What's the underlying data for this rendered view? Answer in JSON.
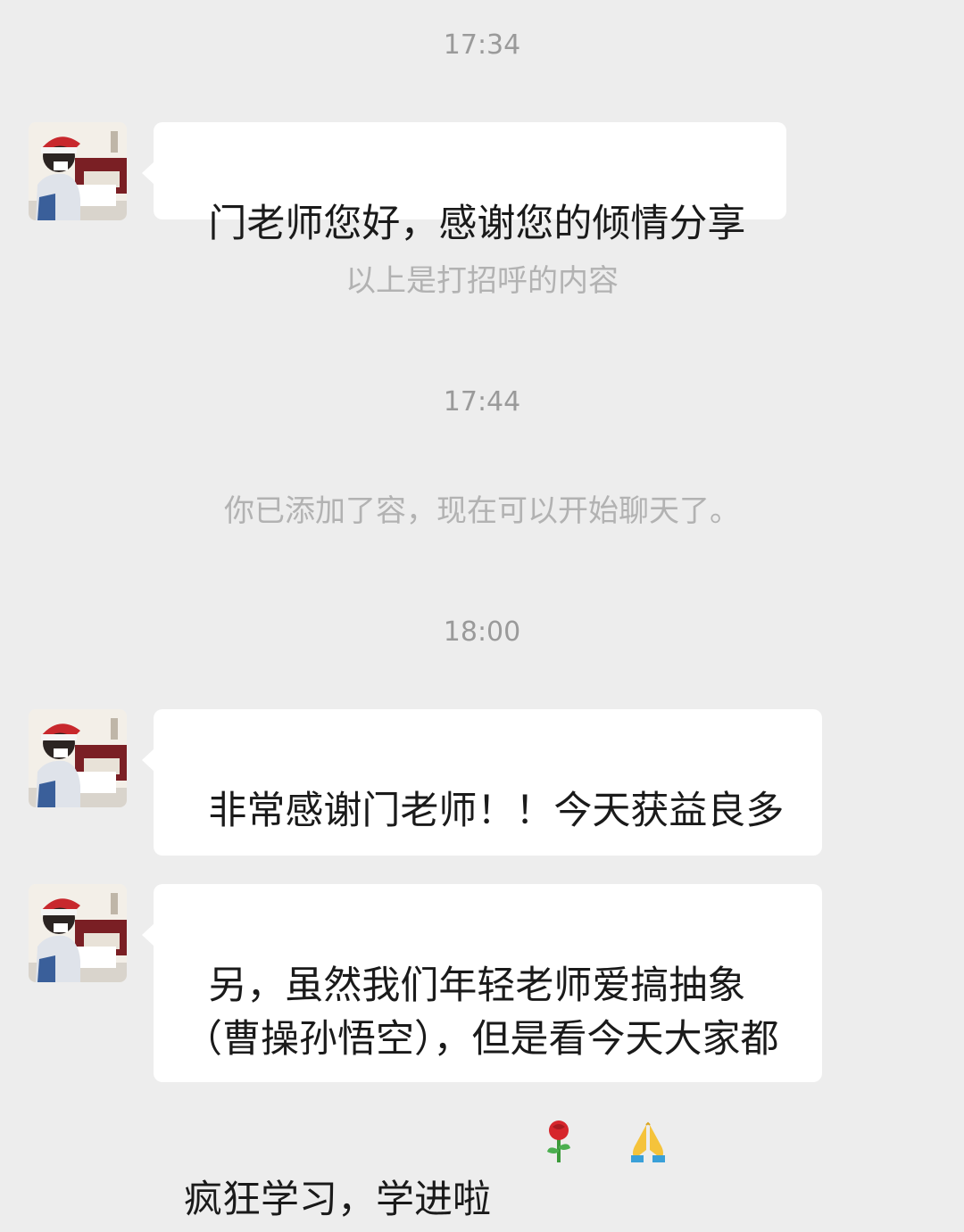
{
  "chat": {
    "timestamps": [
      "17:34",
      "17:44",
      "18:00"
    ],
    "system_notices": [
      "以上是打招呼的内容",
      "你已添加了容，现在可以开始聊天了。"
    ],
    "messages": [
      {
        "text": "门老师您好，感谢您的倾情分享",
        "emoji": []
      },
      {
        "text": "非常感谢门老师！！今天获益良多\n",
        "emoji": [
          "rose-icon"
        ]
      },
      {
        "text": "另，虽然我们年轻老师爱搞抽象（曹操孙悟空），但是看今天大家都疯狂学习，学进啦",
        "emoji": [
          "rose-icon",
          "folded-hands-icon"
        ]
      }
    ]
  },
  "colors": {
    "background": "#ededed",
    "bubble": "#ffffff",
    "timestamp_text": "#9a9a9a",
    "notice_text": "#b2b2b2",
    "message_text": "#1a1a1a"
  }
}
